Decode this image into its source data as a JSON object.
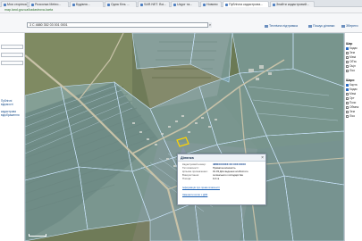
{
  "browser": {
    "tabs": [
      {
        "label": "Моя сторінка"
      },
      {
        "label": "Розсилка Meteo..."
      },
      {
        "label": "Будівля..."
      },
      {
        "label": "Одна біль ..."
      },
      {
        "label": "SAR.NET. Всі..."
      },
      {
        "label": "Uzgor та..."
      },
      {
        "label": "Новини"
      },
      {
        "label": "Публічна кадастрова..."
      },
      {
        "label": "Знайти кадастровий..."
      }
    ],
    "url": "map.land.gov.ua/kadastrova-karta"
  },
  "toolbar": {
    "search_value": "3 C 4880 352 03 001 0001",
    "search_button": "⌕",
    "link_public": "Технічна підтримка",
    "link_layers": "Пошук ділянки",
    "link_tools": "Збереги"
  },
  "left_panel": {
    "rows": [
      "",
      "",
      ""
    ],
    "texts": [
      {
        "text": "Публічні"
      },
      {
        "text": "відомості"
      },
      {
        "text": "кадастрова"
      },
      {
        "text": "відображення"
      }
    ]
  },
  "right_panel": {
    "heading1": "Шар",
    "items1": [
      "Кадас",
      "Зем",
      "Межі",
      "Об'єк",
      "Оцін",
      "Лісо"
    ],
    "heading2": "Шари",
    "items2": [
      "Карта",
      "Кадас",
      "Межі",
      "Орт",
      "Пози",
      "Обмеж",
      "Зем",
      "Лісо"
    ]
  },
  "popup": {
    "title": "Ділянка",
    "rows": [
      {
        "k": "Кадастровий номер:",
        "v": "4880XXXXXX:XX:XXX:XXXX",
        "hl": true
      },
      {
        "k": "Тип власності:",
        "v": "Приватна власність"
      },
      {
        "k": "Цільове призначення:",
        "v": "01.03 Для ведення особистого"
      },
      {
        "k": "Використання:",
        "v": "селянського господарства"
      },
      {
        "k": "Площа:",
        "v": "0.2 га"
      },
      {
        "k": "",
        "v": ""
      }
    ],
    "link1": "Інформація про право власності",
    "link2": "Замовити витяг з ДЗК"
  },
  "map": {
    "scale_label": ""
  }
}
